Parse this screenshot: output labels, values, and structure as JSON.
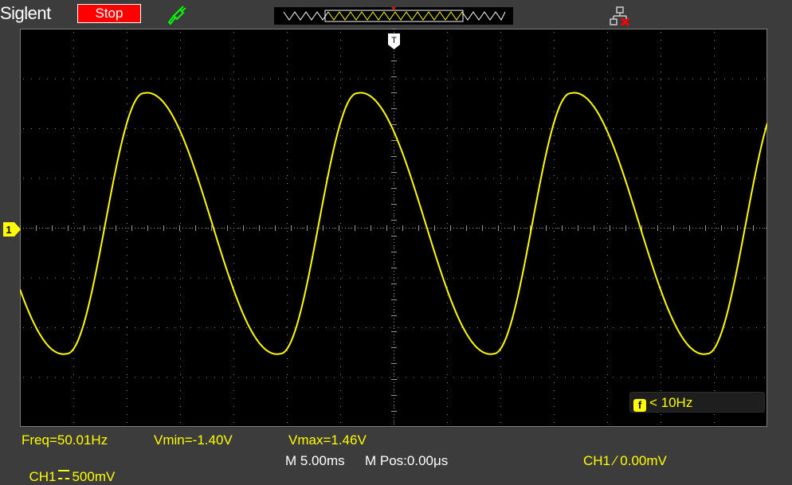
{
  "header": {
    "brand": "Siglent",
    "run_state": "Stop",
    "probe_icon": "probe-icon",
    "network_icon": "lan-disconnected-icon",
    "trigger_top_marker": "T"
  },
  "markers": {
    "trigger_position_label": "T",
    "ch1_ground_label": "1"
  },
  "trigger_freq": {
    "icon_label": "f",
    "value": "< 10Hz"
  },
  "measurements": {
    "freq": "Freq=50.01Hz",
    "vmin": "Vmin=-1.40V",
    "vmax": "Vmax=1.46V"
  },
  "status": {
    "ch1_label": "CH1",
    "ch1_scale": "500mV",
    "timebase": "M 5.00ms",
    "mpos": "M Pos:0.00μs",
    "trigger": "CH1 ∕ 0.00mV"
  },
  "colors": {
    "ch1": "#ffff00",
    "stop": "#ff0000",
    "probe": "#00ff00",
    "status_text": "#ffff00"
  },
  "waveform": {
    "frequency_hz": 50.01,
    "vmin_v": -1.4,
    "vmax_v": 1.46,
    "volts_per_div": 0.5,
    "time_per_div_ms": 5.0,
    "cycles_visible": 4
  }
}
